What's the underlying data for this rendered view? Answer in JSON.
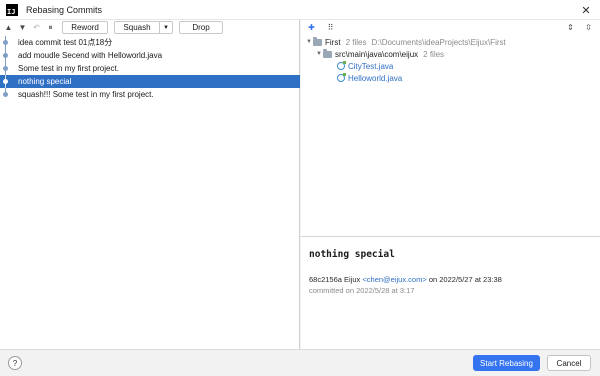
{
  "window": {
    "app_icon_text": "IJ",
    "title": "Rebasing Commits",
    "close_glyph": "✕"
  },
  "toolbar": {
    "move_up_icon": "▲",
    "move_down_icon": "▼",
    "undo_icon": "↶",
    "pause_icon": "⏸",
    "reword_label": "Reword",
    "squash_label": "Squash",
    "squash_dropdown_icon": "▼",
    "drop_label": "Drop"
  },
  "commits": [
    {
      "message": "idea commit test 01点18分",
      "selected": false
    },
    {
      "message": "add moudle Secend with Helloworld.java",
      "selected": false
    },
    {
      "message": "Some test in my first project.",
      "selected": false
    },
    {
      "message": "nothing special",
      "selected": true
    },
    {
      "message": "squash!!! Some test in my first project.",
      "selected": false
    }
  ],
  "changes_toolbar": {
    "pin_icon": "✚",
    "group_icon": "⠿",
    "expand_icon": "⇕",
    "collapse_icon": "⇳"
  },
  "tree": {
    "root": {
      "name": "First",
      "count": "2 files",
      "path": "D:\\Documents\\ideaProjects\\Eijux\\First"
    },
    "folder": {
      "name": "src\\main\\java\\com\\eijux",
      "count": "2 files"
    },
    "files": [
      "CityTest.java",
      "Helloworld.java"
    ]
  },
  "details": {
    "title": "nothing special",
    "hash": "68c2156a",
    "author": "Eijux",
    "email": "<chen@eijux.com>",
    "authored_prefix": "on",
    "authored_date": "2022/5/27 at 23:38",
    "committed_text": "committed on 2022/5/28 at 3:17"
  },
  "footer": {
    "help_label": "?",
    "start_label": "Start Rebasing",
    "cancel_label": "Cancel"
  },
  "colors": {
    "accent": "#3574f0",
    "selection": "#2f6fc4",
    "link": "#2f6fc4"
  }
}
